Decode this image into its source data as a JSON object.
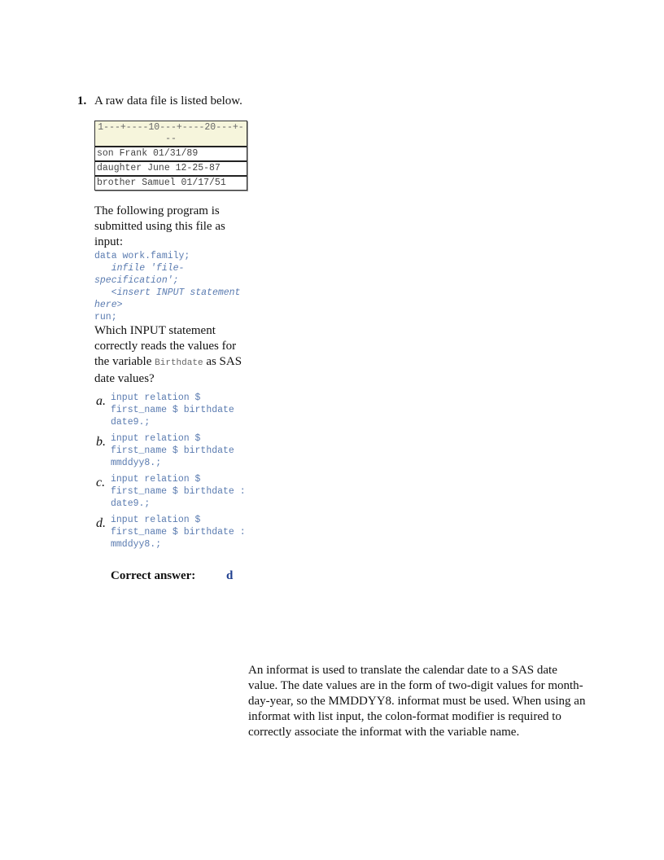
{
  "question": {
    "number": "1.",
    "intro": "A raw data file is listed below.",
    "raw_table": {
      "ruler": "1---+----10---+----20---+---",
      "rows": [
        "son Frank 01/31/89",
        "daughter June    12-25-87",
        "brother Samuel 01/17/51"
      ]
    },
    "program_intro": "The following program is submitted using this file as input:",
    "program_lines": [
      "data work.family;",
      "   infile 'file-specification';",
      "   <insert INPUT statement here>",
      "run;"
    ],
    "prompt_before": "Which INPUT statement correctly reads the values for the variable ",
    "prompt_var": "Birthdate",
    "prompt_after": " as SAS date values?",
    "options": [
      {
        "letter": "a.",
        "code": "input relation $ first_name $ birthdate date9.;"
      },
      {
        "letter": "b.",
        "code": "input relation $ first_name $ birthdate mmddyy8.;"
      },
      {
        "letter": "c.",
        "code": "input relation $ first_name $ birthdate : date9.;"
      },
      {
        "letter": "d.",
        "code": "input relation $ first_name $ birthdate : mmddyy8.;"
      }
    ],
    "correct_label": "Correct answer:",
    "correct_value": "d"
  },
  "explanation": "An informat is used to translate the calendar date to a SAS date value. The date values are in the form of two-digit values for month-day-year, so the MMDDYY8. informat must be used. When using an informat with list input, the colon-format modifier is required to correctly associate the informat with the variable name."
}
